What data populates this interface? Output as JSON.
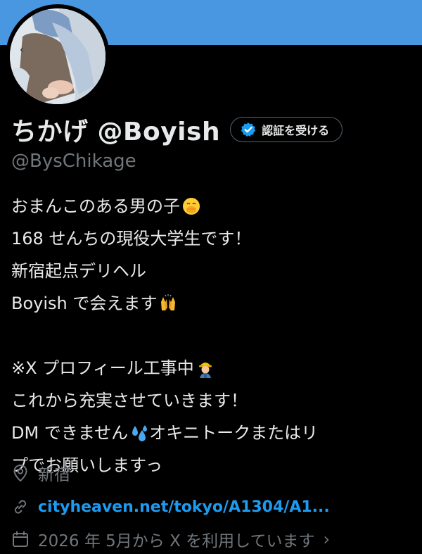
{
  "profile": {
    "display_name": "ちかげ @Boyish",
    "handle": "@BysChikage",
    "verify_button_label": "認証を受ける"
  },
  "bio": {
    "line1": "おまんこのある男の子",
    "line2": "168 せんちの現役大学生です！",
    "line3": "新宿起点デリヘル",
    "line4": "Boyish で会えます",
    "line5": "※X プロフィール工事中",
    "line6": "これから充実させていきます！",
    "line7a": "DM できません",
    "line7b": "オキニトークまたはリ",
    "line8": "プでお願いしますっ"
  },
  "meta": {
    "location": "新宿",
    "link": "cityheaven.net/tokyo/A1304/A1...",
    "joined": "2026 年 5月から X を利用しています",
    "chevron": "›"
  },
  "icons": {
    "verify": "verified-badge-icon",
    "location": "location-pin-icon",
    "link": "link-chain-icon",
    "calendar": "calendar-icon",
    "emoji1": "hand-over-mouth-emoji",
    "emoji2": "raising-hands-emoji",
    "emoji3": "construction-worker-emoji",
    "emoji4": "sweat-droplets-emoji"
  },
  "colors": {
    "banner": "#4a97e1",
    "background": "#000000",
    "text": "#e7e9ea",
    "muted": "#71767b",
    "link": "#1d9bf0"
  }
}
